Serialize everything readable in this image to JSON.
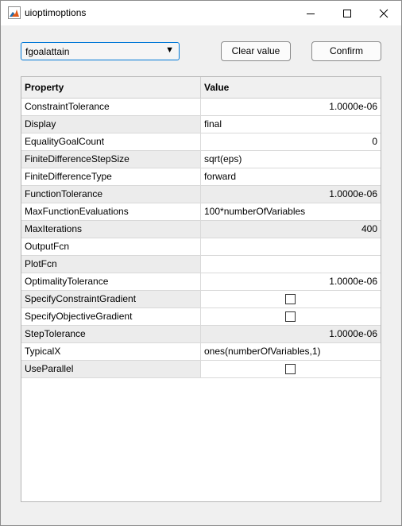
{
  "window": {
    "title": "uioptimoptions",
    "icon": "matlab-icon",
    "controls": [
      "minimize-icon",
      "maximize-icon",
      "close-icon"
    ]
  },
  "solver_dropdown": {
    "selected": "fgoalattain",
    "caret": "▼"
  },
  "buttons": {
    "clear_label": "Clear value",
    "confirm_label": "Confirm"
  },
  "table": {
    "headers": {
      "property": "Property",
      "value": "Value"
    },
    "rows": [
      {
        "property": "ConstraintTolerance",
        "value": "1.0000e-06",
        "kind": "num"
      },
      {
        "property": "Display",
        "value": "final",
        "kind": "text"
      },
      {
        "property": "EqualityGoalCount",
        "value": "0",
        "kind": "num"
      },
      {
        "property": "FiniteDifferenceStepSize",
        "value": "sqrt(eps)",
        "kind": "text"
      },
      {
        "property": "FiniteDifferenceType",
        "value": "forward",
        "kind": "text"
      },
      {
        "property": "FunctionTolerance",
        "value": "1.0000e-06",
        "kind": "num"
      },
      {
        "property": "MaxFunctionEvaluations",
        "value": "100*numberOfVariables",
        "kind": "text"
      },
      {
        "property": "MaxIterations",
        "value": "400",
        "kind": "num"
      },
      {
        "property": "OutputFcn",
        "value": "",
        "kind": "text"
      },
      {
        "property": "PlotFcn",
        "value": "",
        "kind": "text"
      },
      {
        "property": "OptimalityTolerance",
        "value": "1.0000e-06",
        "kind": "num"
      },
      {
        "property": "SpecifyConstraintGradient",
        "value": false,
        "kind": "check"
      },
      {
        "property": "SpecifyObjectiveGradient",
        "value": false,
        "kind": "check"
      },
      {
        "property": "StepTolerance",
        "value": "1.0000e-06",
        "kind": "num"
      },
      {
        "property": "TypicalX",
        "value": "ones(numberOfVariables,1)",
        "kind": "text"
      },
      {
        "property": "UseParallel",
        "value": false,
        "kind": "check"
      }
    ]
  }
}
